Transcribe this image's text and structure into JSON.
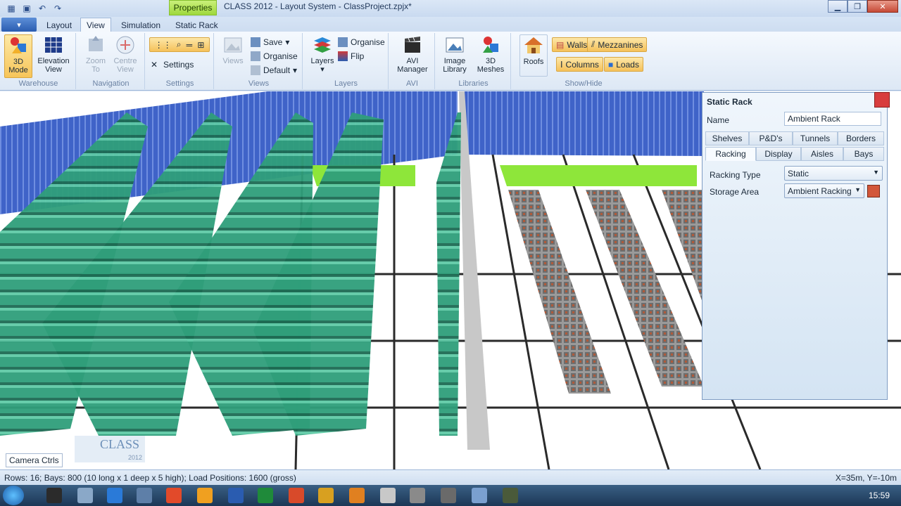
{
  "window": {
    "title": "CLASS 2012 - Layout System - ClassProject.zpjx*",
    "context_tab": "Properties",
    "controls": [
      "minimize",
      "restore",
      "close"
    ]
  },
  "ribbon_tabs": [
    "Layout",
    "View",
    "Simulation",
    "Static Rack"
  ],
  "ribbon": {
    "warehouse": {
      "label": "Warehouse",
      "mode3d": "3D\nMode",
      "elevation": "Elevation\nView"
    },
    "navigation": {
      "label": "Navigation",
      "zoom": "Zoom\nTo",
      "centre": "Centre\nView"
    },
    "settings": {
      "label": "Settings",
      "settings_btn": "Settings"
    },
    "views": {
      "label": "Views",
      "views_btn": "Views",
      "save": "Save",
      "organise": "Organise",
      "default": "Default"
    },
    "layers": {
      "label": "Layers",
      "layers_btn": "Layers",
      "organise": "Organise",
      "flip": "Flip"
    },
    "avi": {
      "label": "AVI",
      "manager": "AVI\nManager"
    },
    "libraries": {
      "label": "Libraries",
      "image": "Image\nLibrary",
      "meshes": "3D\nMeshes"
    },
    "showhide": {
      "label": "Show/Hide",
      "roofs": "Roofs",
      "walls": "Walls",
      "mezzanines": "Mezzanines",
      "columns": "Columns",
      "loads": "Loads"
    }
  },
  "panel": {
    "title": "Static Rack",
    "name_label": "Name",
    "name_value": "Ambient Rack",
    "tabs_row1": [
      "Shelves",
      "P&D's",
      "Tunnels",
      "Borders"
    ],
    "tabs_row2": [
      "Racking",
      "Display",
      "Aisles",
      "Bays"
    ],
    "racking_type_label": "Racking Type",
    "racking_type_value": "Static",
    "storage_area_label": "Storage Area",
    "storage_area_value": "Ambient Racking"
  },
  "viewport": {
    "camera_ctrls": "Camera Ctrls",
    "logo_text": "CLASS",
    "logo_year": "2012"
  },
  "status": {
    "left": "Rows: 16; Bays: 800 (10 long x 1 deep x 5 high); Load Positions: 1600 (gross)",
    "right": "X=35m, Y=-10m"
  },
  "taskbar": {
    "clock": "15:59"
  },
  "colors": {
    "rack_green": "#2f9e7a",
    "rack_grey": "#8a8a8a",
    "wall_blue": "#3f63c8",
    "floor_highlight": "#8ee63a"
  }
}
